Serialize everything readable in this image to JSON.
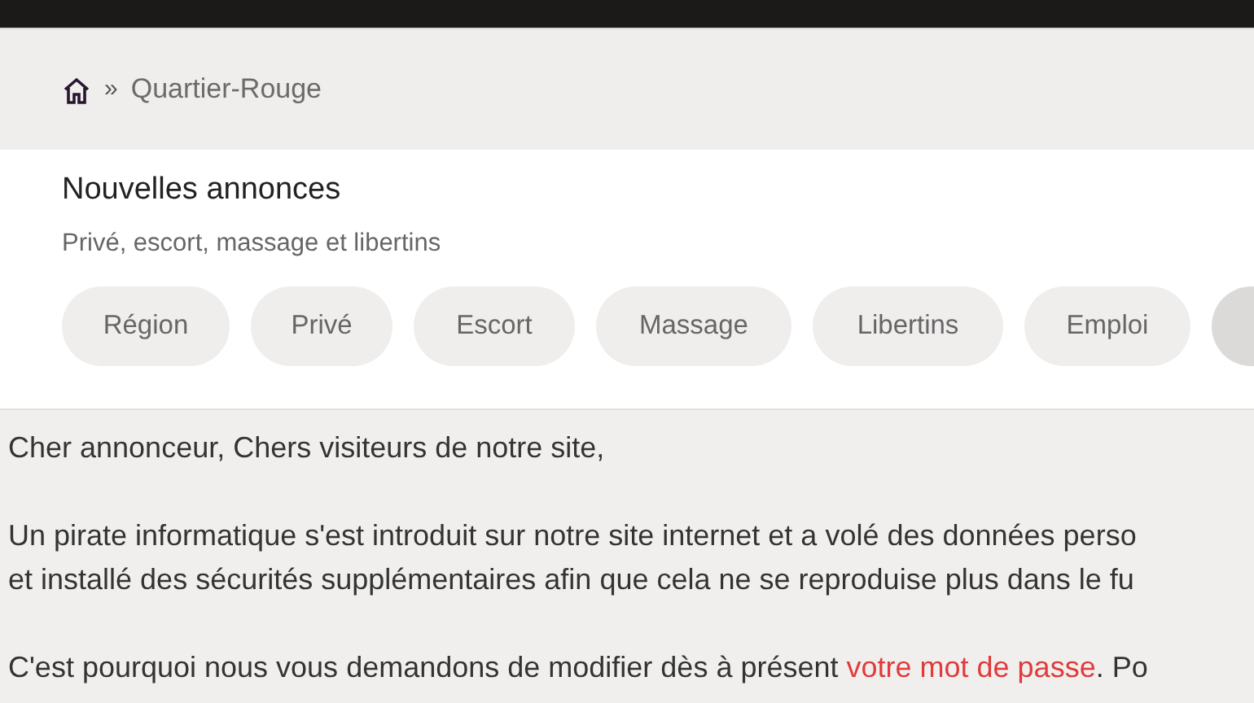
{
  "breadcrumb": {
    "separator": "»",
    "current": "Quartier-Rouge"
  },
  "header": {
    "title": "Nouvelles annonces",
    "subtitle": "Privé, escort, massage et libertins"
  },
  "categories": [
    {
      "label": "Région",
      "selected": false
    },
    {
      "label": "Privé",
      "selected": false
    },
    {
      "label": "Escort",
      "selected": false
    },
    {
      "label": "Massage",
      "selected": false
    },
    {
      "label": "Libertins",
      "selected": false
    },
    {
      "label": "Emploi",
      "selected": false
    },
    {
      "selected": true
    }
  ],
  "message": {
    "paragraphs": [
      {
        "lines": [
          "Cher annonceur, Chers visiteurs de notre site,"
        ]
      },
      {
        "lines": [
          "Un pirate informatique s'est introduit sur notre site internet et a volé des données perso",
          "et installé des sécurités supplémentaires afin que cela ne se reproduise plus dans le fu"
        ]
      },
      {
        "before": "C'est pourquoi nous vous demandons de modifier dès à présent ",
        "link": "votre mot de passe",
        "after": ". Po"
      }
    ]
  }
}
